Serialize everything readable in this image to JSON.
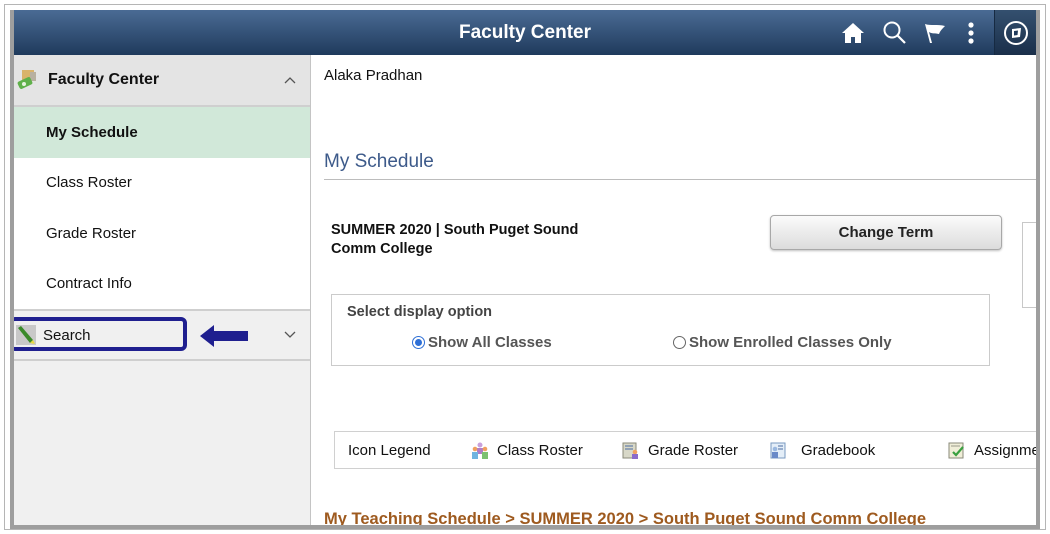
{
  "header": {
    "title": "Faculty Center",
    "icons": [
      "home-icon",
      "search-icon",
      "flag-icon",
      "more-options-icon",
      "navbar-compass-icon"
    ]
  },
  "sidebar": {
    "header_label": "Faculty Center",
    "header_icon": "faculty-center-icon",
    "items": [
      {
        "label": "My Schedule",
        "active": true
      },
      {
        "label": "Class Roster",
        "active": false
      },
      {
        "label": "Grade Roster",
        "active": false
      },
      {
        "label": "Contract Info",
        "active": false
      }
    ],
    "search_label": "Search",
    "search_icon": "flashlight-icon"
  },
  "annotation": {
    "highlight_color": "#1f1f8f",
    "arrow": "left-arrow pointing to Search"
  },
  "main": {
    "user_name": "Alaka Pradhan",
    "page_title": "My Schedule",
    "term": "SUMMER 2020 | South Puget Sound Comm College",
    "change_term_label": "Change Term",
    "display_option": {
      "label": "Select display option",
      "options": [
        {
          "label": "Show All Classes",
          "checked": true
        },
        {
          "label": "Show Enrolled Classes Only",
          "checked": false
        }
      ]
    },
    "icon_legend": {
      "title": "Icon Legend",
      "items": [
        {
          "label": "Class Roster",
          "icon": "class-roster-icon"
        },
        {
          "label": "Grade Roster",
          "icon": "grade-roster-icon"
        },
        {
          "label": "Gradebook",
          "icon": "gradebook-icon"
        },
        {
          "label": "Assignme",
          "icon": "assignment-icon"
        }
      ]
    },
    "breadcrumb": "My Teaching Schedule > SUMMER 2020 > South Puget Sound Comm College"
  },
  "colors": {
    "header_bg": "#2c4a70",
    "active_item_bg": "#d1e8d9",
    "page_title": "#3d5a8a",
    "breadcrumb": "#9e5a1f",
    "radio_selected": "#2e6fd6"
  }
}
